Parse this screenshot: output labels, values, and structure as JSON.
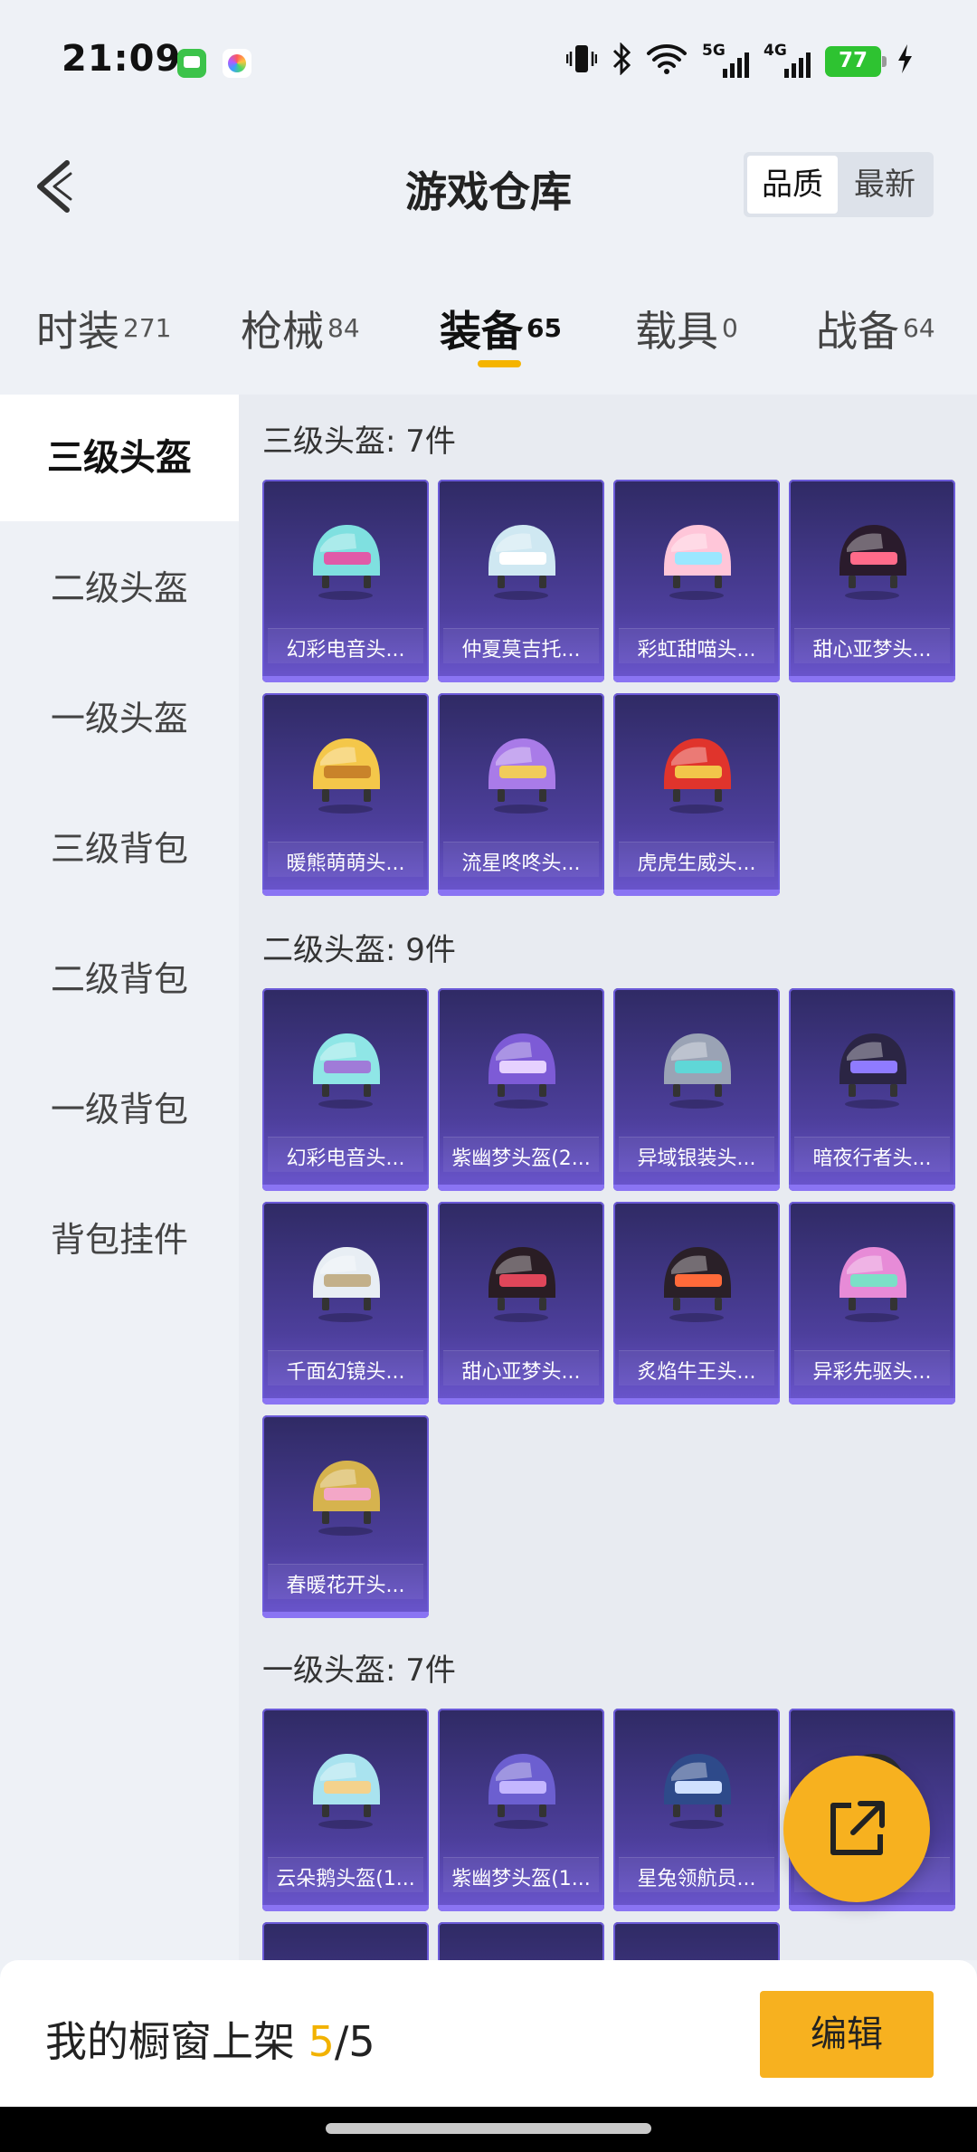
{
  "status_bar": {
    "time": "21:09",
    "net1_label": "5G",
    "net2_label": "4G",
    "battery": "77",
    "icons": [
      "message-icon",
      "photos-icon",
      "vibrate-icon",
      "bluetooth-icon",
      "wifi-icon",
      "signal-icon",
      "battery-icon",
      "charging-icon"
    ]
  },
  "header": {
    "title": "游戏仓库",
    "sort": {
      "quality": "品质",
      "newest": "最新",
      "active": "quality"
    }
  },
  "tabs": [
    {
      "name": "时装",
      "count": "271"
    },
    {
      "name": "枪械",
      "count": "84"
    },
    {
      "name": "装备",
      "count": "65",
      "active": true
    },
    {
      "name": "载具",
      "count": "0"
    },
    {
      "name": "战备",
      "count": "64"
    }
  ],
  "sidebar": {
    "items": [
      "三级头盔",
      "二级头盔",
      "一级头盔",
      "三级背包",
      "二级背包",
      "一级背包",
      "背包挂件"
    ],
    "active_index": 0
  },
  "sections": [
    {
      "title": "三级头盔: 7件",
      "items": [
        "幻彩电音头...",
        "仲夏莫吉托...",
        "彩虹甜喵头...",
        "甜心亚梦头...",
        "暖熊萌萌头...",
        "流星咚咚头...",
        "虎虎生威头..."
      ]
    },
    {
      "title": "二级头盔: 9件",
      "items": [
        "幻彩电音头...",
        "紫幽梦头盔(2...",
        "异域银装头...",
        "暗夜行者头...",
        "千面幻镜头...",
        "甜心亚梦头...",
        "炙焰牛王头...",
        "异彩先驱头...",
        "春暖花开头..."
      ]
    },
    {
      "title": "一级头盔: 7件",
      "items": [
        "云朵鹅头盔(1...",
        "紫幽梦头盔(1...",
        "星兔领航员...",
        ""
      ]
    }
  ],
  "bottom_bar": {
    "showcase_label": "我的橱窗上架 ",
    "showcase_current": "5",
    "showcase_total": "/5",
    "edit_label": "编辑"
  },
  "colors": {
    "accent": "#f7b11f",
    "card_top": "#2f2a64",
    "card_bottom": "#6b56cf"
  }
}
